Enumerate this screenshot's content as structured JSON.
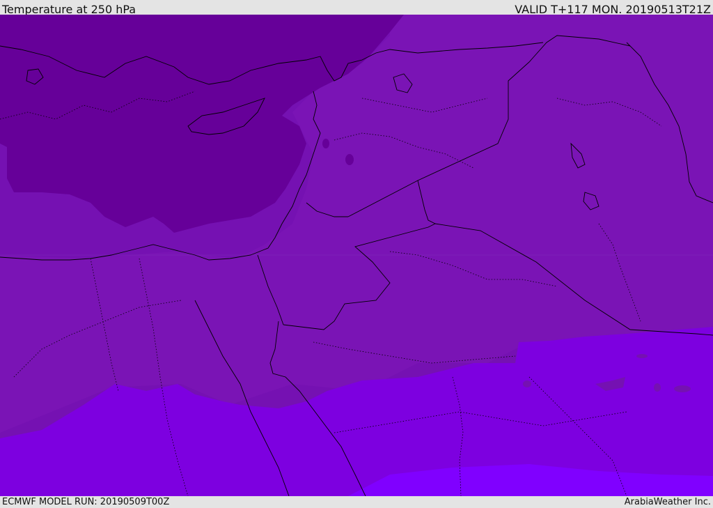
{
  "header": {
    "title": "Temperature at 250 hPa",
    "valid_time": "VALID T+117 MON. 20190513T21Z"
  },
  "footer": {
    "model_run": "ECMWF MODEL RUN: 20190509T00Z",
    "credit": "ArabiaWeather Inc."
  },
  "map": {
    "variable": "temperature",
    "level": "250 hPa",
    "region": "Eastern Mediterranean / Middle East",
    "colors": {
      "coldest_band": "#660099",
      "cold_band": "#7511b2",
      "mid_band": "#7a12b8",
      "warm_band": "#7d00e0",
      "warmest_band": "#8000ff",
      "border": "#000000"
    }
  }
}
